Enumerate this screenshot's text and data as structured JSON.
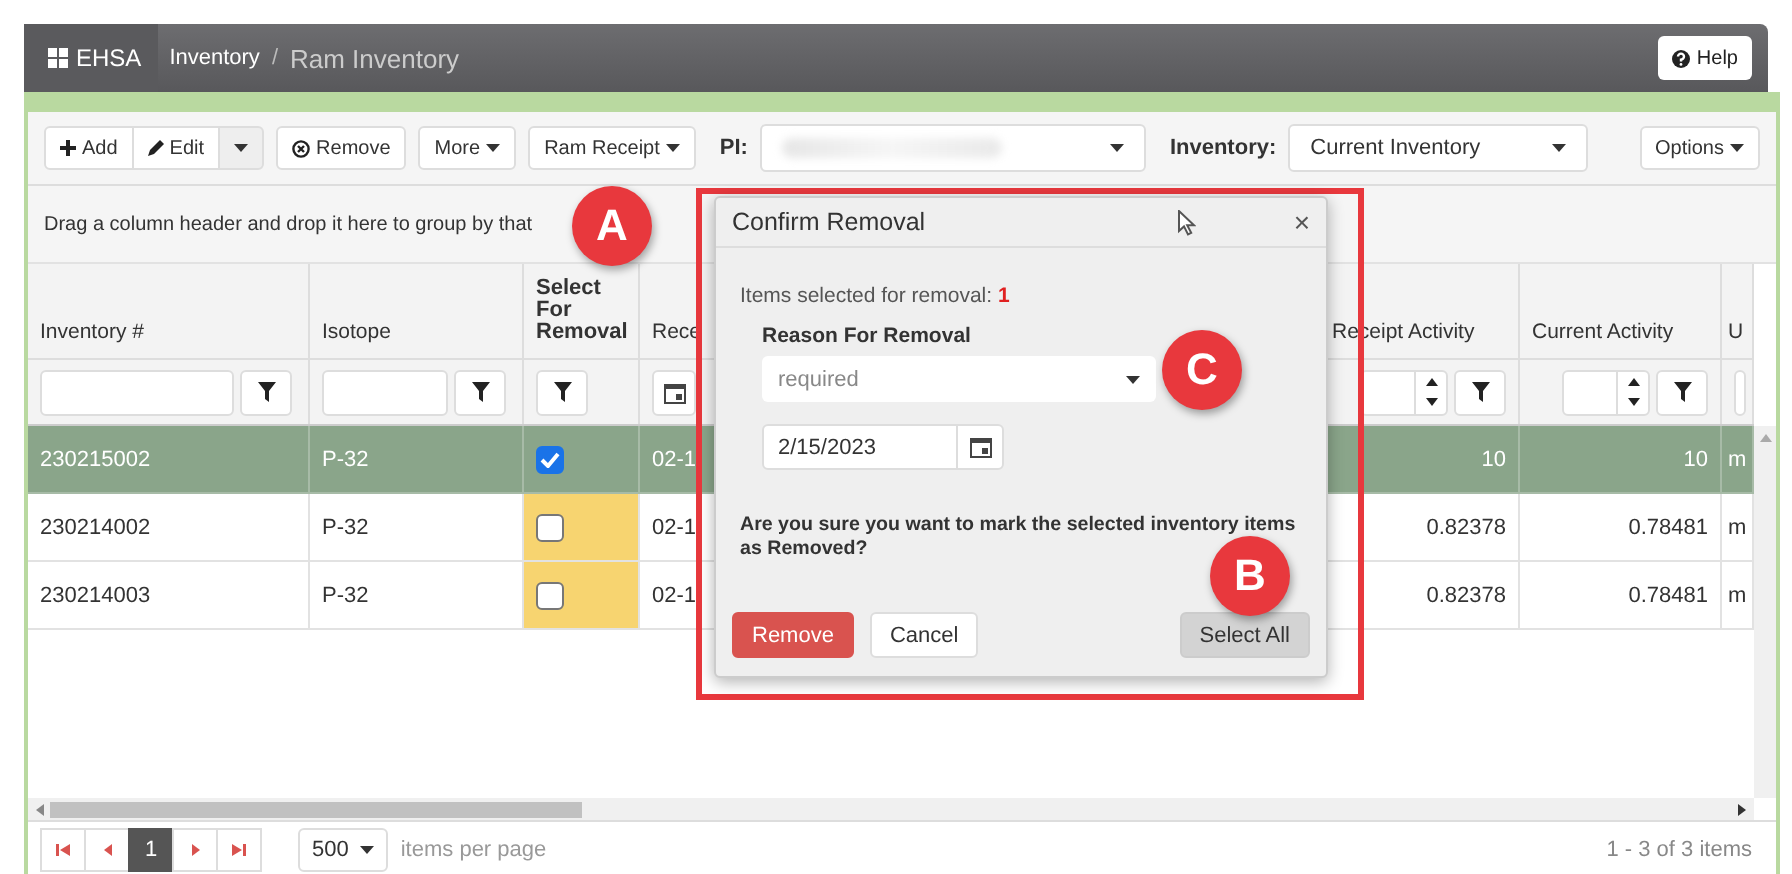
{
  "header": {
    "brand": "EHSA",
    "breadcrumbs": [
      "Inventory",
      "Ram Inventory"
    ],
    "separator": "/",
    "help": "Help"
  },
  "toolbar": {
    "buttons": [
      {
        "label": "Add",
        "kind": "add"
      },
      {
        "label": "Edit",
        "kind": "edit"
      },
      {
        "kind": "split"
      },
      {
        "label": "Remove",
        "kind": "remove"
      },
      {
        "label": "More",
        "kind": "menu"
      },
      {
        "label": "Ram Receipt",
        "kind": "menu"
      }
    ],
    "pi_label": "PI:",
    "inventory_label": "Inventory:",
    "inventory_value": "Current Inventory",
    "options": "Options"
  },
  "group_hint": "Drag a column header and drop it here to group by that",
  "grid": {
    "columns": [
      {
        "title": "Inventory #",
        "kind": "text"
      },
      {
        "title": "Isotope",
        "kind": "text"
      },
      {
        "title": "Select For Removal",
        "kind": "check"
      },
      {
        "title": "Rece",
        "kind": "date"
      },
      {
        "title": "Receipt Activity",
        "kind": "number"
      },
      {
        "title": "Current Activity",
        "kind": "number"
      },
      {
        "title": "U",
        "kind": "stub"
      }
    ],
    "rows": [
      {
        "selected": true,
        "checked": true,
        "cells": [
          "230215002",
          "P-32",
          "",
          "02-1",
          "10",
          "10",
          "m"
        ]
      },
      {
        "selected": false,
        "checked": false,
        "cells": [
          "230214002",
          "P-32",
          "",
          "02-1",
          "0.82378",
          "0.78481",
          "m"
        ]
      },
      {
        "selected": false,
        "checked": false,
        "cells": [
          "230214003",
          "P-32",
          "",
          "02-1",
          "0.82378",
          "0.78481",
          "m"
        ]
      }
    ]
  },
  "pager": {
    "pages": [
      {
        "label": "1",
        "selected": true
      }
    ],
    "page_size": "500",
    "page_size_label": "items per page",
    "summary": "1 - 3 of 3 items"
  },
  "dialog": {
    "title": "Confirm Removal",
    "close": "×",
    "count_label": "Items selected for removal:",
    "count": "1",
    "reason_label": "Reason For Removal",
    "reason_placeholder": "required",
    "date": "2/15/2023",
    "question": "Are you sure you want to mark the selected inventory items as Removed?",
    "buttons": [
      {
        "label": "Remove",
        "kind": "danger"
      },
      {
        "label": "Cancel",
        "kind": "default"
      },
      {
        "label": "Select All",
        "kind": "secondary"
      }
    ]
  },
  "callouts": [
    {
      "letter": "A"
    },
    {
      "letter": "C"
    },
    {
      "letter": "B"
    }
  ]
}
